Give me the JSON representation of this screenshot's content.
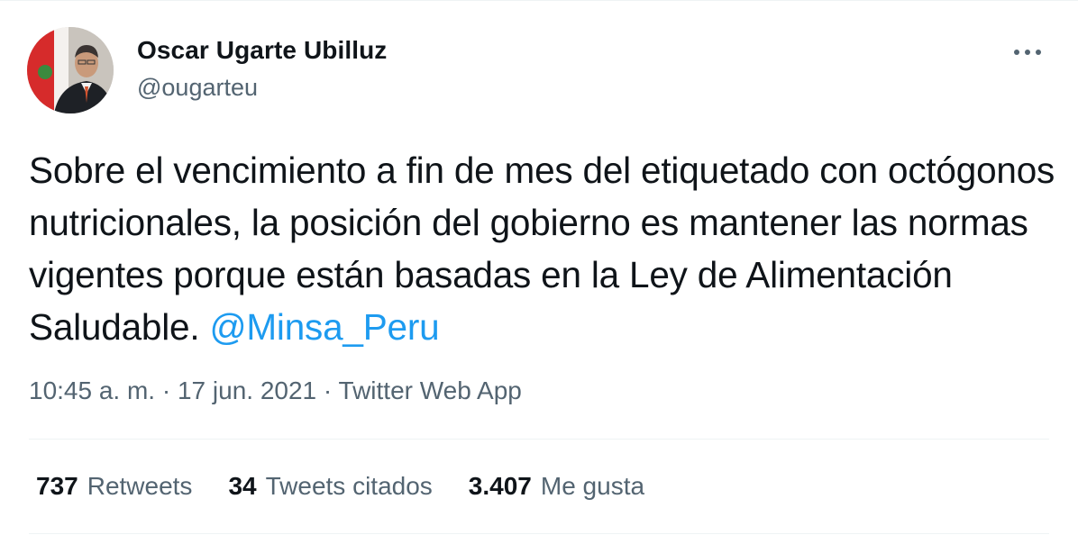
{
  "author": {
    "name": "Oscar Ugarte Ubilluz",
    "handle": "@ougarteu"
  },
  "tweet": {
    "text": "Sobre el vencimiento a fin de mes del etiquetado con octógonos nutricionales, la posición del gobierno es mantener las normas vigentes porque están basadas en la Ley de Alimentación Saludable. ",
    "mention": "@Minsa_Peru"
  },
  "meta": {
    "time": "10:45 a. m.",
    "separator": "·",
    "date": "17 jun. 2021",
    "source": "Twitter Web App"
  },
  "stats": {
    "retweets_count": "737",
    "retweets_label": "Retweets",
    "quotes_count": "34",
    "quotes_label": "Tweets citados",
    "likes_count": "3.407",
    "likes_label": "Me gusta"
  },
  "icons": {
    "more": "more-dots-icon"
  },
  "colors": {
    "link": "#1d9bf0",
    "secondary": "#536471",
    "primary": "#0f1419"
  }
}
